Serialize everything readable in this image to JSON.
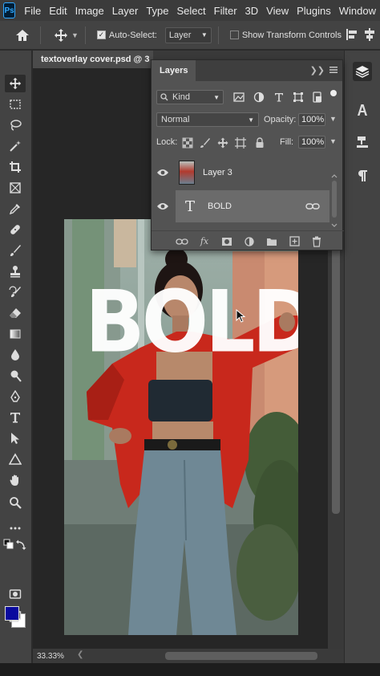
{
  "app": {
    "logo_text": "Ps"
  },
  "menu": [
    "File",
    "Edit",
    "Image",
    "Layer",
    "Type",
    "Select",
    "Filter",
    "3D",
    "View",
    "Plugins",
    "Window"
  ],
  "options": {
    "auto_select_label": "Auto-Select:",
    "auto_select_checked": true,
    "auto_select_target": "Layer",
    "show_transform_label": "Show Transform Controls",
    "show_transform_checked": false
  },
  "document": {
    "tab_title": "textoverlay cover.psd @ 3",
    "zoom": "33.33%",
    "overlay_text": "BOLD"
  },
  "layers_panel": {
    "tab_label": "Layers",
    "filter_kind": "Kind",
    "blend_mode": "Normal",
    "opacity_label": "Opacity:",
    "opacity_value": "100%",
    "lock_label": "Lock:",
    "fill_label": "Fill:",
    "fill_value": "100%",
    "layers": [
      {
        "name": "Layer 3",
        "type": "image",
        "visible": true,
        "selected": false
      },
      {
        "name": "BOLD",
        "type": "text",
        "visible": true,
        "selected": true
      }
    ],
    "footer_fx": "fx"
  },
  "colors": {
    "foreground": "#0a0a9e",
    "background": "#ffffff",
    "jacket": "#c8281c"
  }
}
